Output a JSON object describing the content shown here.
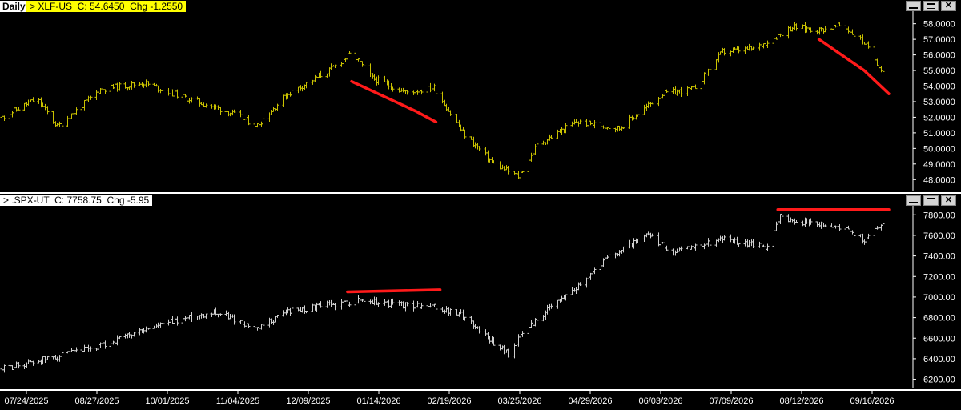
{
  "labels": {
    "period": "Daily",
    "top_title": "> XLF-US  C: 54.6450  Chg -1.2550",
    "bottom_title": "> .SPX-UT  C: 7758.75  Chg -5.95",
    "close_glyph": "✕"
  },
  "colors": {
    "background": "#000000",
    "xlf_bars": "#c9c100",
    "spx_bars": "#d0d0d0",
    "annotation": "#ff1a1a",
    "axis": "#ffffff",
    "separator": "#ffffff"
  },
  "chart_data": [
    {
      "type": "ohlc",
      "symbol": "XLF-US",
      "close": 54.645,
      "change": -1.255,
      "ylim": [
        47.5,
        58.6
      ],
      "y_ticks": [
        "48.0000",
        "49.0000",
        "50.0000",
        "51.0000",
        "52.0000",
        "53.0000",
        "54.0000",
        "55.0000",
        "56.0000",
        "57.0000",
        "58.0000"
      ],
      "approx_close_path": [
        [
          "2025-07-24",
          52.0
        ],
        [
          "2025-08-10",
          53.2
        ],
        [
          "2025-08-20",
          51.4
        ],
        [
          "2025-09-10",
          53.8
        ],
        [
          "2025-10-01",
          54.2
        ],
        [
          "2025-10-20",
          53.3
        ],
        [
          "2025-11-10",
          52.4
        ],
        [
          "2025-11-25",
          51.5
        ],
        [
          "2025-12-10",
          53.5
        ],
        [
          "2025-12-30",
          55.0
        ],
        [
          "2026-01-10",
          56.1
        ],
        [
          "2026-01-20",
          54.5
        ],
        [
          "2026-02-05",
          53.6
        ],
        [
          "2026-02-19",
          53.9
        ],
        [
          "2026-03-05",
          51.0
        ],
        [
          "2026-03-20",
          49.0
        ],
        [
          "2026-04-01",
          48.2
        ],
        [
          "2026-04-10",
          50.2
        ],
        [
          "2026-04-29",
          51.7
        ],
        [
          "2026-05-20",
          51.3
        ],
        [
          "2026-06-10",
          53.5
        ],
        [
          "2026-06-25",
          53.8
        ],
        [
          "2026-07-09",
          56.2
        ],
        [
          "2026-07-25",
          56.4
        ],
        [
          "2026-08-12",
          57.8
        ],
        [
          "2026-08-25",
          57.6
        ],
        [
          "2026-09-05",
          57.9
        ],
        [
          "2026-09-16",
          56.8
        ],
        [
          "2026-09-22",
          55.5
        ],
        [
          "2026-09-27",
          54.645
        ]
      ],
      "annotations": [
        {
          "kind": "trendline",
          "color": "red",
          "points": [
            [
              "2026-01-10",
              54.3
            ],
            [
              "2026-02-10",
              52.4
            ],
            [
              "2026-02-20",
              51.7
            ]
          ]
        },
        {
          "kind": "trendline",
          "color": "red",
          "points": [
            [
              "2026-08-25",
              57.0
            ],
            [
              "2026-09-16",
              55.0
            ],
            [
              "2026-09-28",
              53.5
            ]
          ]
        }
      ]
    },
    {
      "type": "ohlc",
      "symbol": ".SPX-UT",
      "close": 7758.75,
      "change": -5.95,
      "ylim": [
        6150,
        7880
      ],
      "y_ticks": [
        "6200.00",
        "6400.00",
        "6600.00",
        "6800.00",
        "7000.00",
        "7200.00",
        "7400.00",
        "7600.00",
        "7800.00"
      ],
      "approx_close_path": [
        [
          "2025-07-24",
          6300
        ],
        [
          "2025-08-10",
          6380
        ],
        [
          "2025-08-20",
          6420
        ],
        [
          "2025-09-10",
          6520
        ],
        [
          "2025-10-01",
          6680
        ],
        [
          "2025-10-15",
          6760
        ],
        [
          "2025-11-04",
          6860
        ],
        [
          "2025-11-15",
          6780
        ],
        [
          "2025-11-25",
          6680
        ],
        [
          "2025-12-09",
          6860
        ],
        [
          "2025-12-30",
          6920
        ],
        [
          "2026-01-14",
          6970
        ],
        [
          "2026-02-05",
          6920
        ],
        [
          "2026-02-19",
          6900
        ],
        [
          "2026-03-05",
          6820
        ],
        [
          "2026-03-20",
          6560
        ],
        [
          "2026-03-27",
          6450
        ],
        [
          "2026-04-05",
          6700
        ],
        [
          "2026-04-29",
          7100
        ],
        [
          "2026-05-15",
          7400
        ],
        [
          "2026-06-03",
          7600
        ],
        [
          "2026-06-15",
          7430
        ],
        [
          "2026-07-09",
          7570
        ],
        [
          "2026-07-30",
          7480
        ],
        [
          "2026-08-06",
          7780
        ],
        [
          "2026-08-20",
          7720
        ],
        [
          "2026-09-05",
          7680
        ],
        [
          "2026-09-16",
          7560
        ],
        [
          "2026-09-27",
          7758.75
        ]
      ],
      "annotations": [
        {
          "kind": "horizontal",
          "color": "red",
          "points": [
            [
              "2026-01-08",
              7050
            ],
            [
              "2026-02-22",
              7070
            ]
          ]
        },
        {
          "kind": "horizontal",
          "color": "red",
          "points": [
            [
              "2026-08-05",
              7850
            ],
            [
              "2026-09-28",
              7850
            ]
          ]
        }
      ]
    }
  ],
  "x_axis": {
    "tick_labels": [
      "07/24/2025",
      "08/27/2025",
      "10/01/2025",
      "11/04/2025",
      "12/09/2025",
      "01/14/2026",
      "02/19/2026",
      "03/25/2026",
      "04/29/2026",
      "06/03/2026",
      "07/09/2026",
      "08/12/2026",
      "09/16/2026"
    ]
  }
}
